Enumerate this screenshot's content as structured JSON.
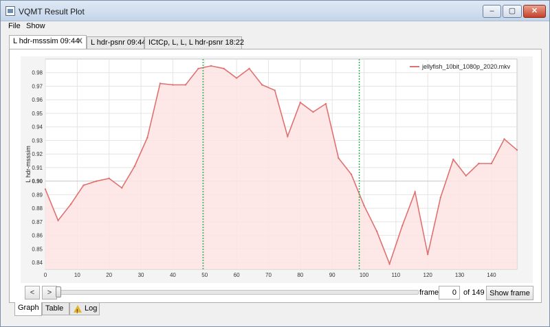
{
  "window": {
    "title": "VQMT Result Plot",
    "minimize_glyph": "‒",
    "maximize_glyph": "▢",
    "close_glyph": "✕"
  },
  "menu": {
    "file": "File",
    "show": "Show"
  },
  "tabs": [
    {
      "label": "L hdr-msssim 09:44",
      "close": "X",
      "active": true
    },
    {
      "label": "L hdr-psnr 09:44",
      "active": false
    },
    {
      "label": "ICtCp, L, L, L hdr-psnr 18:22",
      "active": false
    }
  ],
  "chart_data": {
    "type": "area",
    "ylabel": "L hdr-msssim",
    "xlabel": "",
    "title": "",
    "xlim": [
      0,
      148
    ],
    "ylim": [
      0.835,
      0.99
    ],
    "x_ticks": [
      0,
      10,
      20,
      30,
      40,
      50,
      60,
      70,
      80,
      90,
      100,
      110,
      120,
      130,
      140
    ],
    "y_ticks": [
      0.84,
      0.85,
      0.86,
      0.87,
      0.88,
      0.89,
      0.9,
      0.91,
      0.92,
      0.93,
      0.94,
      0.95,
      0.96,
      0.97,
      0.98
    ],
    "y_tick_labels": [
      "0.84",
      "0.85",
      "0.86",
      "0.87",
      "0.88",
      "0.89",
      "0.90",
      "0.91",
      "0.92",
      "0.93",
      "0.94",
      "0.95",
      "0.96",
      "0.97",
      "0.98"
    ],
    "highlight_y": 0.9,
    "markers_x": [
      49.5,
      98.5
    ],
    "grid": true,
    "legend_position": "top-right",
    "series": [
      {
        "name": "jellyfish_10bit_1080p_2020.mkv",
        "color": "#e07070",
        "fill": "#fde3e3",
        "x": [
          0,
          4,
          8,
          12,
          16,
          20,
          24,
          28,
          32,
          36,
          40,
          44,
          48,
          52,
          56,
          60,
          64,
          68,
          72,
          76,
          80,
          84,
          88,
          92,
          96,
          100,
          104,
          108,
          112,
          116,
          120,
          124,
          128,
          132,
          136,
          140,
          144,
          148
        ],
        "values": [
          0.894,
          0.871,
          0.883,
          0.897,
          0.9,
          0.902,
          0.895,
          0.911,
          0.932,
          0.972,
          0.971,
          0.971,
          0.983,
          0.985,
          0.983,
          0.976,
          0.983,
          0.971,
          0.967,
          0.933,
          0.958,
          0.951,
          0.957,
          0.917,
          0.905,
          0.882,
          0.863,
          0.839,
          0.867,
          0.892,
          0.846,
          0.888,
          0.916,
          0.904,
          0.913,
          0.913,
          0.931,
          0.923
        ]
      }
    ],
    "marker_color": "#2dad5a"
  },
  "controls": {
    "prev_label": "<",
    "next_label": ">",
    "frame_label": "frame",
    "frame_value": "0",
    "of_label": "of 149",
    "show_frame_label": "Show frame"
  },
  "bottom_tabs": [
    {
      "label": "Graph",
      "active": true
    },
    {
      "label": "Table",
      "active": false
    },
    {
      "label": "Log",
      "active": false,
      "icon": "warning-icon"
    }
  ]
}
